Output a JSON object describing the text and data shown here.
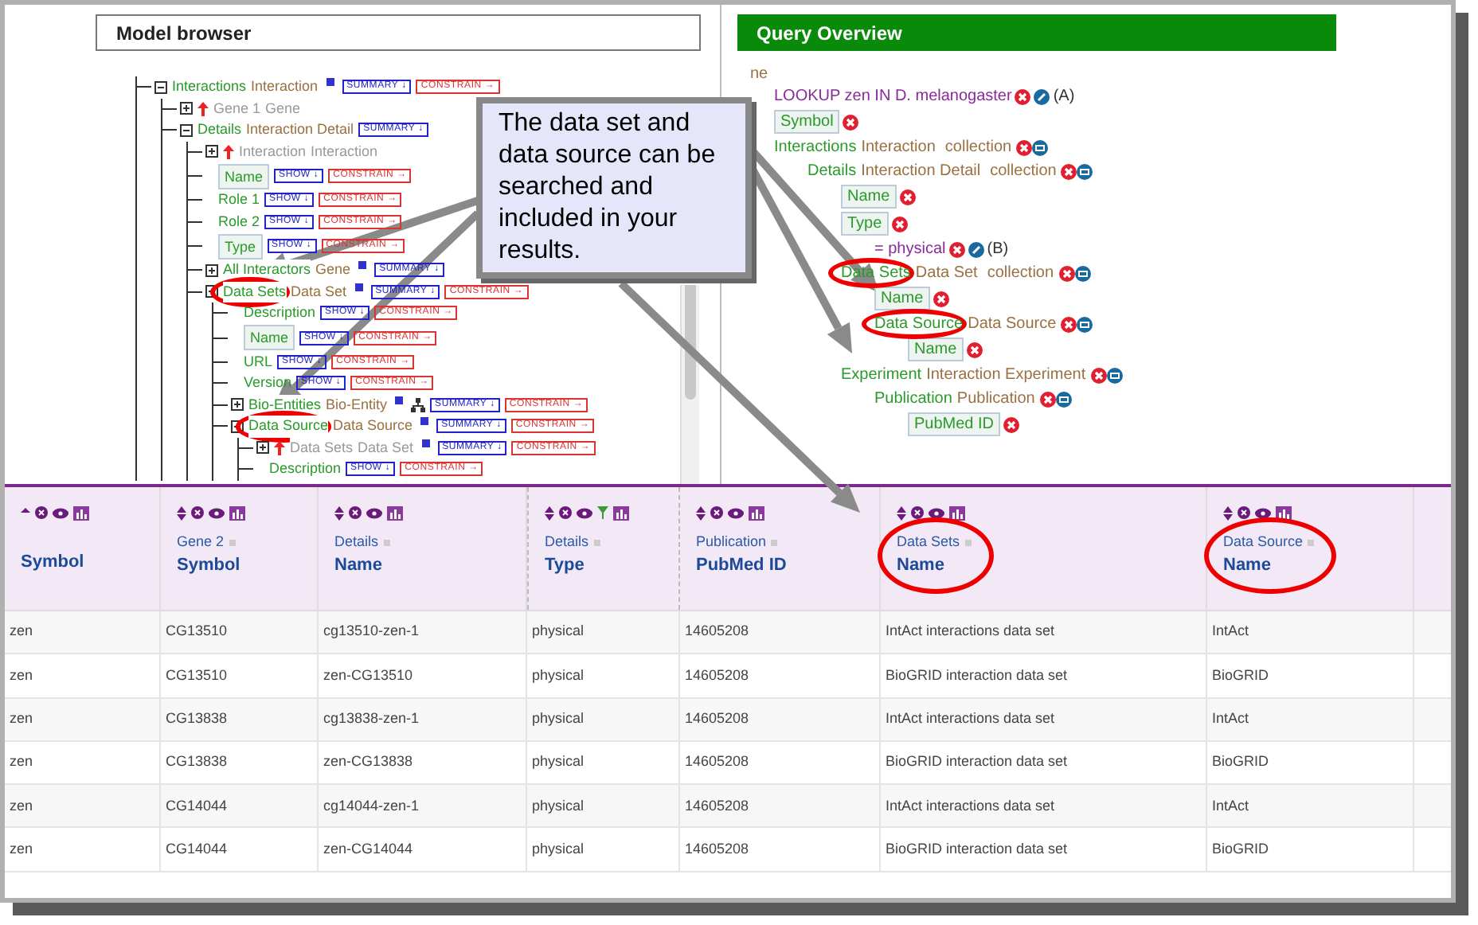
{
  "model_browser": {
    "title": "Model browser",
    "tree": [
      {
        "kind": "reference",
        "name": "Interactions",
        "type": "Interaction",
        "expanded": true,
        "info": true,
        "buttons": [
          "SUMMARY ↓",
          "CONSTRAIN →"
        ],
        "children": [
          {
            "kind": "reverse_reference",
            "name": "Gene 1",
            "type": "Gene",
            "expanded": false
          },
          {
            "kind": "reference",
            "name": "Details",
            "type": "Interaction Detail",
            "expanded": true,
            "buttons": [
              "SUMMARY ↓"
            ],
            "children": [
              {
                "kind": "reverse_reference",
                "name": "Interaction",
                "type": "Interaction",
                "expanded": false
              },
              {
                "kind": "attribute",
                "name": "Name",
                "in_view": true,
                "buttons": [
                  "SHOW ↓",
                  "CONSTRAIN →"
                ]
              },
              {
                "kind": "attribute",
                "name": "Role 1",
                "in_view": false,
                "buttons": [
                  "SHOW ↓",
                  "CONSTRAIN →"
                ]
              },
              {
                "kind": "attribute",
                "name": "Role 2",
                "in_view": false,
                "buttons": [
                  "SHOW ↓",
                  "CONSTRAIN →"
                ]
              },
              {
                "kind": "attribute",
                "name": "Type",
                "in_view": true,
                "buttons": [
                  "SHOW ↓",
                  "CONSTRAIN →"
                ]
              },
              {
                "kind": "reference",
                "name": "All Interactors",
                "type": "Gene",
                "expanded": false,
                "info": true,
                "buttons": [
                  "SUMMARY ↓"
                ]
              },
              {
                "kind": "reference",
                "name": "Data Sets",
                "type": "Data Set",
                "expanded": true,
                "info": true,
                "highlighted": true,
                "buttons": [
                  "SUMMARY ↓",
                  "CONSTRAIN →"
                ],
                "children": [
                  {
                    "kind": "attribute",
                    "name": "Description",
                    "in_view": false,
                    "buttons": [
                      "SHOW ↓",
                      "CONSTRAIN →"
                    ]
                  },
                  {
                    "kind": "attribute",
                    "name": "Name",
                    "in_view": true,
                    "buttons": [
                      "SHOW ↓",
                      "CONSTRAIN →"
                    ]
                  },
                  {
                    "kind": "attribute",
                    "name": "URL",
                    "in_view": false,
                    "buttons": [
                      "SHOW ↓",
                      "CONSTRAIN →"
                    ]
                  },
                  {
                    "kind": "attribute",
                    "name": "Version",
                    "in_view": false,
                    "buttons": [
                      "SHOW ↓",
                      "CONSTRAIN →"
                    ]
                  },
                  {
                    "kind": "reference",
                    "name": "Bio-Entities",
                    "type": "Bio-Entity",
                    "expanded": false,
                    "info": true,
                    "subclass_icon": true,
                    "buttons": [
                      "SUMMARY ↓",
                      "CONSTRAIN →"
                    ]
                  },
                  {
                    "kind": "reference",
                    "name": "Data Source",
                    "type": "Data Source",
                    "expanded": true,
                    "info": true,
                    "highlighted": true,
                    "buttons": [
                      "SUMMARY ↓",
                      "CONSTRAIN →"
                    ],
                    "children": [
                      {
                        "kind": "reverse_reference",
                        "name": "Data Sets",
                        "type": "Data Set",
                        "expanded": false,
                        "info": true,
                        "buttons": [
                          "SUMMARY ↓",
                          "CONSTRAIN →"
                        ]
                      },
                      {
                        "kind": "attribute",
                        "name": "Description",
                        "in_view": false,
                        "buttons": [
                          "SHOW ↓",
                          "CONSTRAIN →"
                        ]
                      }
                    ]
                  }
                ]
              }
            ]
          }
        ]
      }
    ]
  },
  "query_overview": {
    "title": "Query Overview",
    "root": "ne",
    "tree": [
      {
        "kind": "constraint",
        "text": "LOOKUP zen IN D. melanogaster",
        "code": "(A)"
      },
      {
        "kind": "attribute",
        "name": "Symbol"
      },
      {
        "kind": "reference",
        "name": "Interactions",
        "type": "Interaction",
        "suffix": "collection",
        "children": [
          {
            "kind": "reference",
            "name": "Details",
            "type": "Interaction Detail",
            "suffix": "collection",
            "children": [
              {
                "kind": "attribute",
                "name": "Name"
              },
              {
                "kind": "attribute",
                "name": "Type",
                "children": [
                  {
                    "kind": "constraint",
                    "text": "= physical",
                    "code": "(B)"
                  }
                ]
              },
              {
                "kind": "reference",
                "name": "Data Sets",
                "type": "Data Set",
                "suffix": "collection",
                "highlighted": true,
                "children": [
                  {
                    "kind": "attribute",
                    "name": "Name"
                  },
                  {
                    "kind": "reference",
                    "name": "Data Source",
                    "type": "Data Source",
                    "highlighted": true,
                    "children": [
                      {
                        "kind": "attribute",
                        "name": "Name"
                      }
                    ]
                  }
                ]
              },
              {
                "kind": "reference",
                "name": "Experiment",
                "type": "Interaction Experiment",
                "children": [
                  {
                    "kind": "reference",
                    "name": "Publication",
                    "type": "Publication",
                    "children": [
                      {
                        "kind": "attribute",
                        "name": "PubMed ID"
                      }
                    ]
                  }
                ]
              }
            ]
          }
        ]
      }
    ]
  },
  "results": {
    "columns": [
      {
        "name": "Symbol",
        "sorted": true,
        "filtered": false,
        "highlighted": false
      },
      {
        "path": "Gene 2",
        "name": "Symbol",
        "sorted": false,
        "filtered": false,
        "highlighted": false
      },
      {
        "path": "Details",
        "name": "Name",
        "sorted": false,
        "filtered": false,
        "highlighted": false
      },
      {
        "path": "Details",
        "name": "Type",
        "sorted": false,
        "filtered": true,
        "highlighted": false
      },
      {
        "path": "Publication",
        "name": "PubMed ID",
        "sorted": false,
        "filtered": false,
        "highlighted": false
      },
      {
        "path": "Data Sets",
        "name": "Name",
        "sorted": false,
        "filtered": false,
        "highlighted": true
      },
      {
        "path": "Data Source",
        "name": "Name",
        "sorted": false,
        "filtered": false,
        "highlighted": true
      }
    ],
    "rows": [
      [
        "zen",
        "CG13510",
        "cg13510-zen-1",
        "physical",
        "14605208",
        "IntAct interactions data set",
        "IntAct"
      ],
      [
        "zen",
        "CG13510",
        "zen-CG13510",
        "physical",
        "14605208",
        "BioGRID interaction data set",
        "BioGRID"
      ],
      [
        "zen",
        "CG13838",
        "cg13838-zen-1",
        "physical",
        "14605208",
        "IntAct interactions data set",
        "IntAct"
      ],
      [
        "zen",
        "CG13838",
        "zen-CG13838",
        "physical",
        "14605208",
        "BioGRID interaction data set",
        "BioGRID"
      ],
      [
        "zen",
        "CG14044",
        "cg14044-zen-1",
        "physical",
        "14605208",
        "IntAct interactions data set",
        "IntAct"
      ],
      [
        "zen",
        "CG14044",
        "zen-CG14044",
        "physical",
        "14605208",
        "BioGRID interaction data set",
        "BioGRID"
      ]
    ]
  },
  "callout": {
    "text": "The data set and data source can be searched and included in your results."
  }
}
